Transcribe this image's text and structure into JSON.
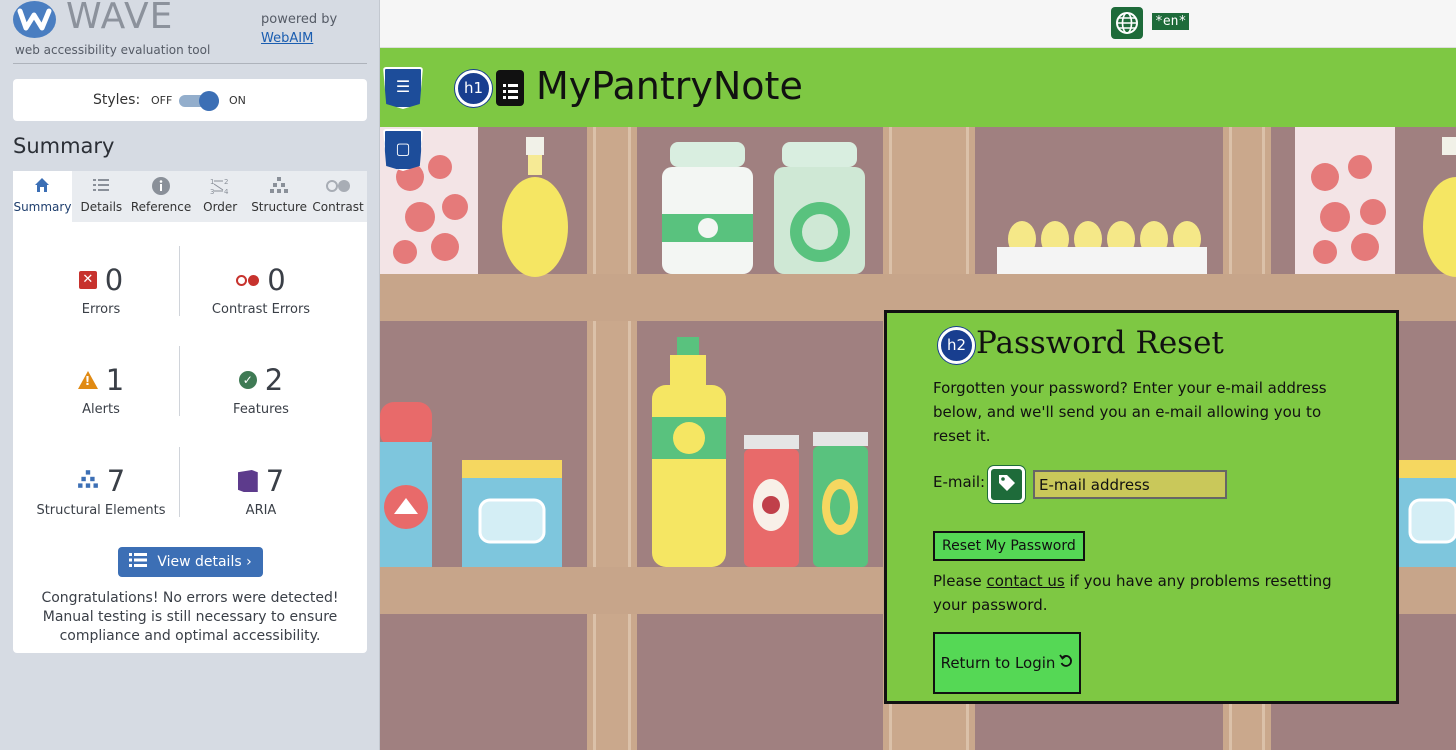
{
  "wave": {
    "logo_text": "WAVE",
    "tagline": "web accessibility evaluation tool",
    "powered_by": "powered by",
    "webaim_link": "WebAIM",
    "styles_label": "Styles:",
    "styles_off": "OFF",
    "styles_on": "ON",
    "summary_heading": "Summary",
    "tabs": [
      {
        "label": "Summary",
        "icon": "home-icon"
      },
      {
        "label": "Details",
        "icon": "list-icon"
      },
      {
        "label": "Reference",
        "icon": "info-icon"
      },
      {
        "label": "Order",
        "icon": "order-icon"
      },
      {
        "label": "Structure",
        "icon": "structure-icon"
      },
      {
        "label": "Contrast",
        "icon": "contrast-icon"
      }
    ],
    "stats": {
      "errors": {
        "count": "0",
        "label": "Errors"
      },
      "contrast_errors": {
        "count": "0",
        "label": "Contrast Errors"
      },
      "alerts": {
        "count": "1",
        "label": "Alerts"
      },
      "features": {
        "count": "2",
        "label": "Features"
      },
      "structural": {
        "count": "7",
        "label": "Structural Elements"
      },
      "aria": {
        "count": "7",
        "label": "ARIA"
      }
    },
    "view_details": "View details ›",
    "congrats": "Congratulations! No errors were detected! Manual testing is still necessary to ensure compliance and optimal accessibility."
  },
  "page": {
    "lang_badge": "*en*",
    "h1_badge": "h1",
    "h2_badge": "h2",
    "site_title": "MyPantryNote",
    "reset_title": "Password Reset",
    "reset_intro": "Forgotten your password? Enter your e-mail address below, and we'll send you an e-mail allowing you to reset it.",
    "email_label": "E-mail:",
    "email_placeholder": "E-mail address",
    "reset_button": "Reset My Password",
    "contact_prefix": "Please ",
    "contact_link": "contact us",
    "contact_suffix": " if you have any problems resetting your password.",
    "return_button": "Return to Login"
  },
  "colors": {
    "wave_accent": "#3c6fb5",
    "header_green": "#7ec843",
    "button_green": "#55d855",
    "error_red": "#c7322d",
    "alert_orange": "#e08a13",
    "feature_green": "#3f7a54",
    "aria_purple": "#5d3b8c"
  }
}
